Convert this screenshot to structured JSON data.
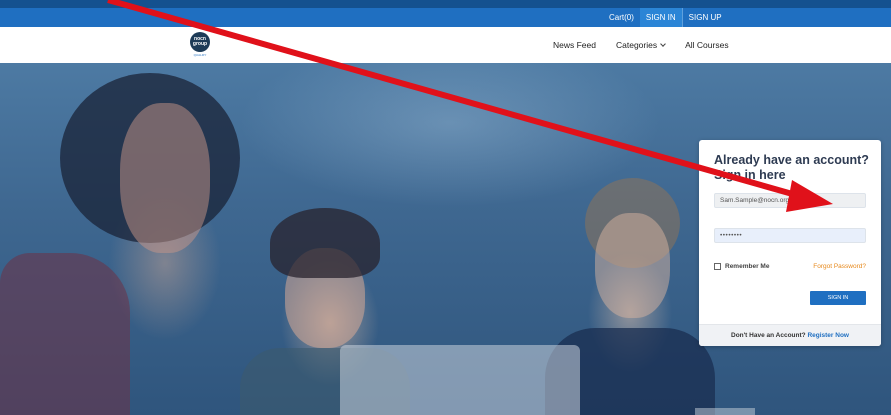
{
  "topbar": {
    "cart": "Cart(0)",
    "sign_in": "SIGN IN",
    "sign_up": "SIGN UP"
  },
  "logo": {
    "mark": "nocn group",
    "sub": "QUALIFY"
  },
  "nav": {
    "news_feed": "News Feed",
    "categories": "Categories",
    "all_courses": "All Courses"
  },
  "login": {
    "heading_line1": "Already have an account?",
    "heading_line2": "Sign in here",
    "email_value": "Sam.Sample@nocn.org",
    "password_value": "••••••••",
    "remember": "Remember Me",
    "forgot": "Forgot Password?",
    "button": "SIGN IN",
    "footer_text": "Don't Have an Account?",
    "register": "Register Now"
  },
  "colors": {
    "brand_blue": "#1f6fc1",
    "accent_orange": "#e7891c",
    "annotation_red": "#e0111a"
  }
}
